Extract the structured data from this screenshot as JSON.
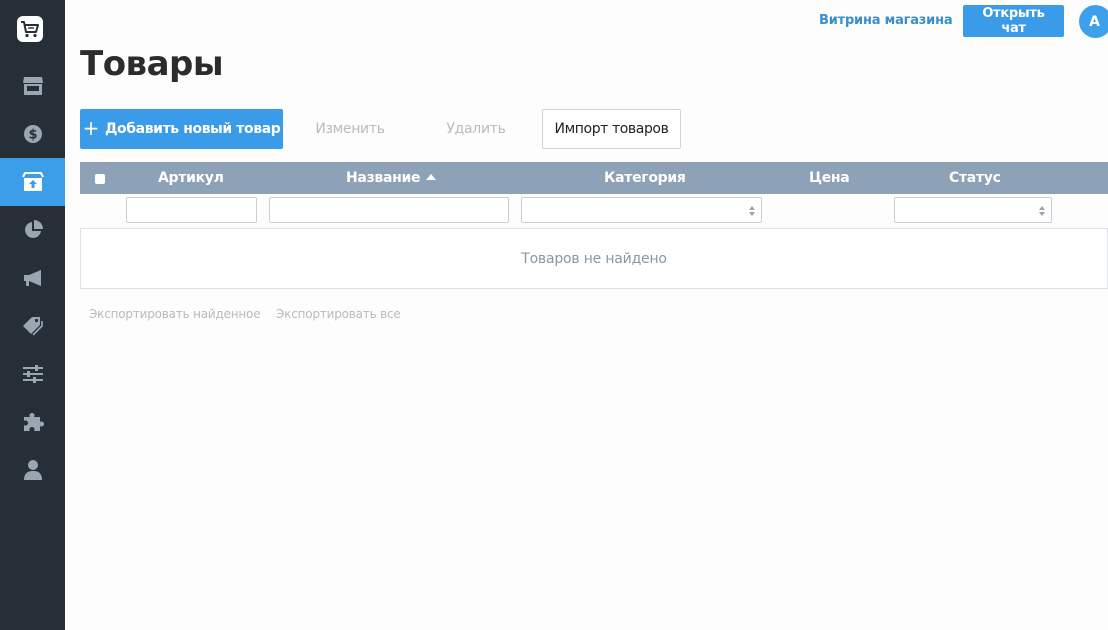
{
  "header": {
    "storefront_link": "Витрина магазина",
    "open_chat": "Открыть чат",
    "avatar_initial": "A"
  },
  "sidebar": {
    "items": [
      {
        "icon": "store-icon",
        "active": false
      },
      {
        "icon": "dollar-icon",
        "active": false
      },
      {
        "icon": "products-upload-icon",
        "active": true
      },
      {
        "icon": "pie-chart-icon",
        "active": false
      },
      {
        "icon": "megaphone-icon",
        "active": false
      },
      {
        "icon": "tags-icon",
        "active": false
      },
      {
        "icon": "sliders-icon",
        "active": false
      },
      {
        "icon": "puzzle-icon",
        "active": false
      },
      {
        "icon": "user-icon",
        "active": false
      }
    ]
  },
  "page": {
    "title": "Товары"
  },
  "toolbar": {
    "add_label": "Добавить новый товар",
    "edit_label": "Изменить",
    "delete_label": "Удалить",
    "import_label": "Импорт товаров"
  },
  "table": {
    "columns": [
      "Артикул",
      "Название",
      "Категория",
      "Цена",
      "Статус"
    ],
    "sorted_column": "Название",
    "empty_message": "Товаров не найдено"
  },
  "footer": {
    "export_found": "Экспортировать найденное",
    "export_all": "Экспортировать все"
  },
  "colors": {
    "sidebar_bg": "#262f38",
    "accent": "#3a9be8",
    "table_header": "#8da2b6"
  }
}
